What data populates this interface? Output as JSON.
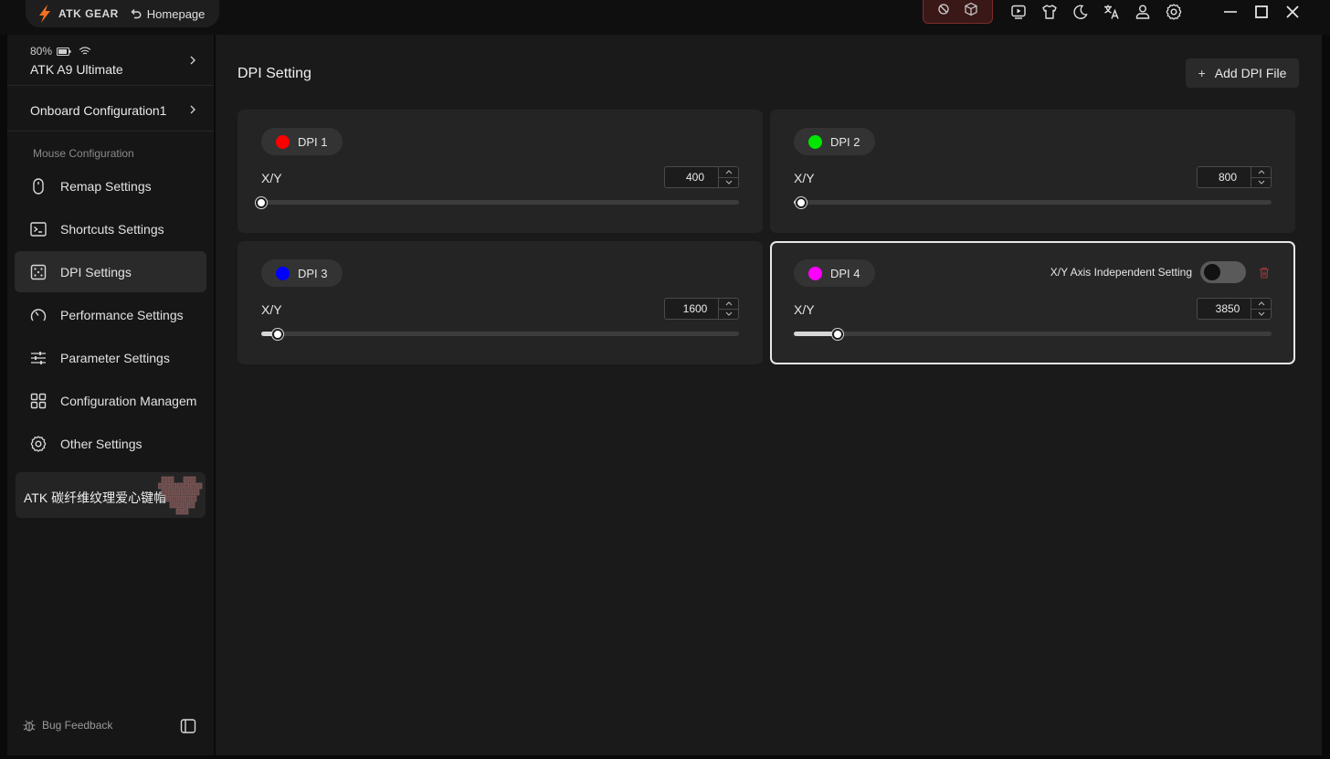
{
  "titlebar": {
    "brand": "ATK GEAR",
    "home_label": "Homepage",
    "icons": [
      "block-icon",
      "cube-icon",
      "video-icon",
      "shirt-icon",
      "moon-icon",
      "translate-icon",
      "user-icon",
      "settings-icon"
    ],
    "window_controls": [
      "minimize-icon",
      "maximize-icon",
      "close-icon"
    ]
  },
  "device": {
    "battery": "80%",
    "name": "ATK A9 Ultimate"
  },
  "onboard": {
    "label": "Onboard Configuration1"
  },
  "sidebar": {
    "section_title": "Mouse Configuration",
    "items": [
      {
        "label": "Remap Settings",
        "icon": "mouse-icon"
      },
      {
        "label": "Shortcuts Settings",
        "icon": "terminal-icon"
      },
      {
        "label": "DPI Settings",
        "icon": "dpi-icon",
        "active": true
      },
      {
        "label": "Performance Settings",
        "icon": "gauge-icon"
      },
      {
        "label": "Parameter Settings",
        "icon": "sliders-icon"
      },
      {
        "label": "Configuration Managem",
        "icon": "grid-icon"
      },
      {
        "label": "Other Settings",
        "icon": "gear-icon"
      }
    ],
    "promo": "ATK 碳纤维纹理爱心键帽",
    "bug_feedback": "Bug Feedback"
  },
  "main": {
    "title": "DPI Setting",
    "add_button": "Add DPI File",
    "dpi_cards": [
      {
        "name": "DPI 1",
        "color": "#ff0000",
        "axis_label": "X/Y",
        "value": "400",
        "level": 0.0
      },
      {
        "name": "DPI 2",
        "color": "#00e600",
        "axis_label": "X/Y",
        "value": "800",
        "level": 0.015
      },
      {
        "name": "DPI 3",
        "color": "#0000ff",
        "axis_label": "X/Y",
        "value": "1600",
        "level": 0.035
      },
      {
        "name": "DPI 4",
        "color": "#ff00ff",
        "axis_label": "X/Y",
        "value": "3850",
        "level": 0.092,
        "selected": true,
        "independent_label": "X/Y Axis Independent Setting",
        "independent_on": false
      }
    ]
  }
}
